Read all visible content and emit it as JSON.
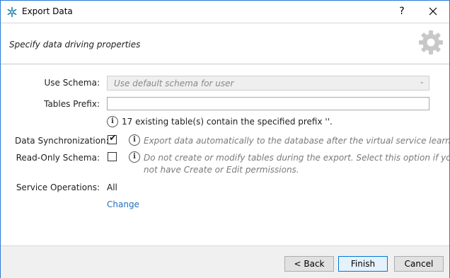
{
  "window": {
    "title": "Export Data",
    "help_label": "?",
    "close_label": "✕"
  },
  "header": {
    "subtitle": "Specify data driving properties"
  },
  "form": {
    "use_schema_label": "Use Schema:",
    "use_schema_value": "Use default schema for user",
    "tables_prefix_label": "Tables Prefix:",
    "tables_prefix_value": "",
    "prefix_note": "17 existing table(s) contain the specified prefix ''.",
    "data_sync_label": "Data Synchronization:",
    "data_sync_checked": true,
    "data_sync_hint": "Export data automatically to the database after the virtual service learning.",
    "readonly_label": "Read-Only Schema:",
    "readonly_checked": false,
    "readonly_hint_line1": "Do not create or modify tables during the export. Select this option if you do",
    "readonly_hint_line2": "not have Create or Edit permissions.",
    "service_ops_label": "Service Operations:",
    "service_ops_value": "All",
    "change_link": "Change"
  },
  "footer": {
    "back_label": "< Back",
    "finish_label": "Finish",
    "cancel_label": "Cancel"
  },
  "icons": {
    "app": "asterisk-app-icon",
    "gear": "gear-icon",
    "info": "info-icon"
  }
}
